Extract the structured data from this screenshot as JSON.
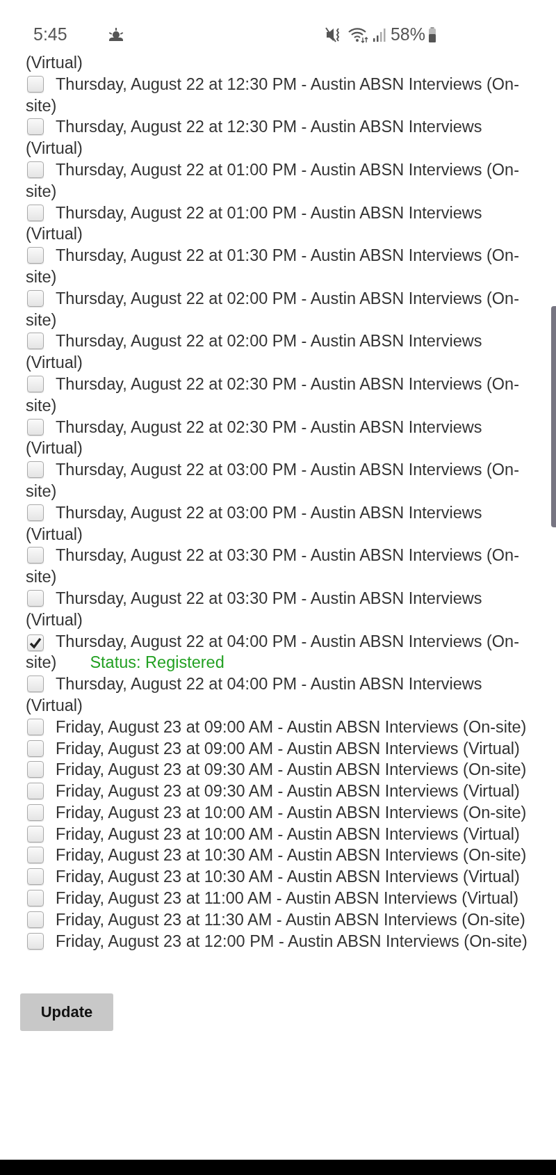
{
  "status_bar": {
    "time": "5:45",
    "battery": "58%"
  },
  "cut_off_text": "(Virtual)",
  "slots": [
    {
      "label": "Thursday, August 22 at 12:30 PM - Austin ABSN Interviews (On-site)",
      "checked": false
    },
    {
      "label": "Thursday, August 22 at 12:30 PM - Austin ABSN Interviews (Virtual)",
      "checked": false
    },
    {
      "label": "Thursday, August 22 at 01:00 PM - Austin ABSN Interviews (On-site)",
      "checked": false
    },
    {
      "label": "Thursday, August 22 at 01:00 PM - Austin ABSN Interviews (Virtual)",
      "checked": false
    },
    {
      "label": "Thursday, August 22 at 01:30 PM - Austin ABSN Interviews (On-site)",
      "checked": false
    },
    {
      "label": "Thursday, August 22 at 02:00 PM - Austin ABSN Interviews (On-site)",
      "checked": false
    },
    {
      "label": "Thursday, August 22 at 02:00 PM - Austin ABSN Interviews (Virtual)",
      "checked": false
    },
    {
      "label": "Thursday, August 22 at 02:30 PM - Austin ABSN Interviews (On-site)",
      "checked": false
    },
    {
      "label": "Thursday, August 22 at 02:30 PM - Austin ABSN Interviews (Virtual)",
      "checked": false
    },
    {
      "label": "Thursday, August 22 at 03:00 PM - Austin ABSN Interviews (On-site)",
      "checked": false
    },
    {
      "label": "Thursday, August 22 at 03:00 PM - Austin ABSN Interviews (Virtual)",
      "checked": false
    },
    {
      "label": "Thursday, August 22 at 03:30 PM - Austin ABSN Interviews (On-site)",
      "checked": false
    },
    {
      "label": "Thursday, August 22 at 03:30 PM - Austin ABSN Interviews (Virtual)",
      "checked": false
    },
    {
      "label": "Thursday, August 22 at 04:00 PM - Austin ABSN Interviews (On-site)",
      "checked": true,
      "status": "Status: Registered"
    },
    {
      "label": "Thursday, August 22 at 04:00 PM - Austin ABSN Interviews (Virtual)",
      "checked": false
    },
    {
      "label": "Friday, August 23 at 09:00 AM - Austin ABSN Interviews (On-site)",
      "checked": false
    },
    {
      "label": "Friday, August 23 at 09:00 AM - Austin ABSN Interviews (Virtual)",
      "checked": false
    },
    {
      "label": "Friday, August 23 at 09:30 AM - Austin ABSN Interviews (On-site)",
      "checked": false
    },
    {
      "label": "Friday, August 23 at 09:30 AM - Austin ABSN Interviews (Virtual)",
      "checked": false
    },
    {
      "label": "Friday, August 23 at 10:00 AM - Austin ABSN Interviews (On-site)",
      "checked": false
    },
    {
      "label": "Friday, August 23 at 10:00 AM - Austin ABSN Interviews (Virtual)",
      "checked": false
    },
    {
      "label": "Friday, August 23 at 10:30 AM - Austin ABSN Interviews (On-site)",
      "checked": false
    },
    {
      "label": "Friday, August 23 at 10:30 AM - Austin ABSN Interviews (Virtual)",
      "checked": false
    },
    {
      "label": "Friday, August 23 at 11:00 AM - Austin ABSN Interviews (Virtual)",
      "checked": false
    },
    {
      "label": "Friday, August 23 at 11:30 AM - Austin ABSN Interviews (On-site)",
      "checked": false
    },
    {
      "label": "Friday, August 23 at 12:00 PM - Austin ABSN Interviews (On-site)",
      "checked": false
    }
  ],
  "buttons": [
    {
      "label": "Update"
    }
  ]
}
